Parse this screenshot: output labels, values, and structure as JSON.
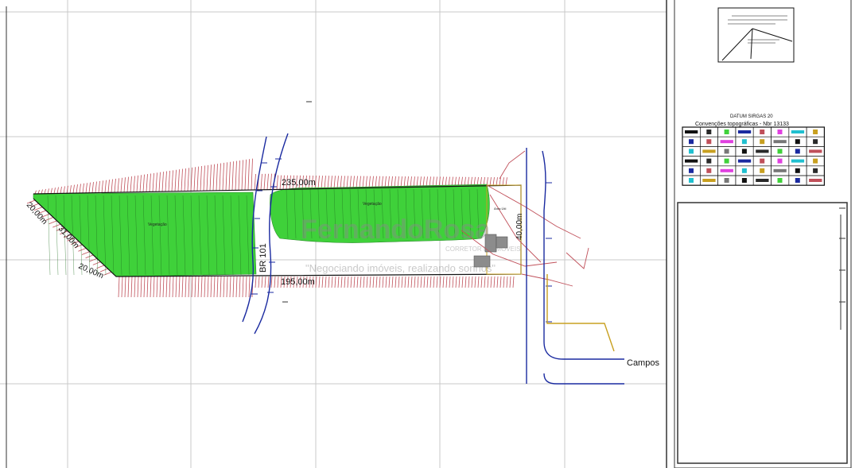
{
  "diagram": {
    "datum_title": "DATUM SIRGAS 20",
    "conventions_title": "Convenções topográficas - Nbr 13133",
    "road_label": "BR 101",
    "street_label": "Campos",
    "area_label_left": "Vegetação",
    "area_label_right": "Vegetação",
    "area_label_small": "Área Útil",
    "dimensions": {
      "top": "235,00m",
      "bottom": "195,00m",
      "right": "40,00m",
      "left_upper": "20,00m",
      "left_middle": "31,00m",
      "left_lower": "20,00m"
    },
    "watermark": {
      "name": "FernandoRosa",
      "role": "CORRETOR DE IMÓVEIS",
      "slogan": "\"Negociando imóveis, realizando sonhos\""
    },
    "colors": {
      "vegetation": "#3fd13a",
      "hatch": "#c0505a",
      "road": "#1a2aa0",
      "grid": "#c8c8c8",
      "boundary": "#111111",
      "access": "#c8a020"
    }
  }
}
